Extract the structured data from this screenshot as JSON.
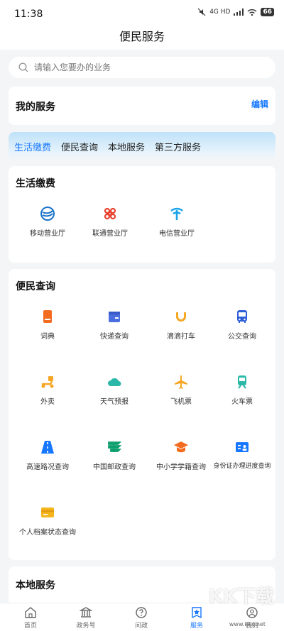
{
  "status": {
    "time": "11:38",
    "network": "4G HD",
    "battery": "66"
  },
  "header": {
    "title": "便民服务"
  },
  "search": {
    "placeholder": "请输入您要办的业务"
  },
  "my_services": {
    "title": "我的服务",
    "edit_label": "编辑"
  },
  "tabs": [
    {
      "label": "生活缴费",
      "active": true
    },
    {
      "label": "便民查询",
      "active": false
    },
    {
      "label": "本地服务",
      "active": false
    },
    {
      "label": "第三方服务",
      "active": false
    }
  ],
  "life_payment": {
    "title": "生活缴费",
    "items": [
      {
        "label": "移动营业厅",
        "icon": "china-mobile-icon"
      },
      {
        "label": "联通营业厅",
        "icon": "china-unicom-icon"
      },
      {
        "label": "电信营业厅",
        "icon": "china-telecom-icon"
      }
    ]
  },
  "convenience_query": {
    "title": "便民查询",
    "items": [
      {
        "label": "词典",
        "icon": "dictionary-icon"
      },
      {
        "label": "快递查询",
        "icon": "package-icon"
      },
      {
        "label": "滴滴打车",
        "icon": "didi-icon"
      },
      {
        "label": "公交查询",
        "icon": "bus-icon"
      },
      {
        "label": "外卖",
        "icon": "scooter-icon"
      },
      {
        "label": "天气预报",
        "icon": "cloud-icon"
      },
      {
        "label": "飞机票",
        "icon": "airplane-icon"
      },
      {
        "label": "火车票",
        "icon": "train-icon"
      },
      {
        "label": "高速路况查询",
        "icon": "highway-icon"
      },
      {
        "label": "中国邮政查询",
        "icon": "china-post-icon"
      },
      {
        "label": "中小学学籍查询",
        "icon": "graduation-cap-icon"
      },
      {
        "label": "身份证办理进度查询",
        "icon": "id-card-icon"
      },
      {
        "label": "个人档案状态查询",
        "icon": "archive-card-icon"
      }
    ]
  },
  "local_services": {
    "title": "本地服务"
  },
  "bottom_nav": [
    {
      "label": "首页",
      "icon": "home-icon",
      "active": false
    },
    {
      "label": "政务号",
      "icon": "government-icon",
      "active": false
    },
    {
      "label": "问政",
      "icon": "question-icon",
      "active": false
    },
    {
      "label": "服务",
      "icon": "service-star-icon",
      "active": true
    },
    {
      "label": "我的",
      "icon": "profile-icon",
      "active": false
    }
  ],
  "watermark": {
    "text": "KK下载",
    "url": "www.kkx.net"
  },
  "colors": {
    "accent": "#1677ff",
    "background": "#f4f5f7"
  }
}
